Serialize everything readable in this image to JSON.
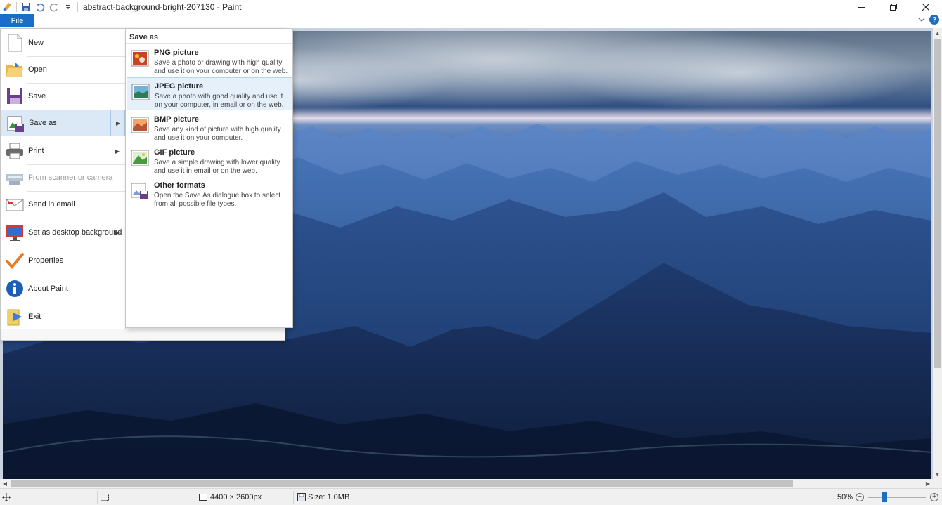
{
  "window": {
    "title": "abstract-background-bright-207130 - Paint",
    "quick_access": [
      "paint-app-icon",
      "save-icon",
      "undo-icon",
      "redo-icon",
      "customize-dropdown-icon"
    ]
  },
  "ribbon": {
    "file_tab": "File",
    "help_icon": "?"
  },
  "file_menu": {
    "items": [
      {
        "label": "New",
        "icon": "new-document-icon",
        "enabled": true,
        "submenu": false
      },
      {
        "label": "Open",
        "icon": "open-folder-icon",
        "enabled": true,
        "submenu": false
      },
      {
        "label": "Save",
        "icon": "save-disk-icon",
        "enabled": true,
        "submenu": false
      },
      {
        "label": "Save as",
        "icon": "save-as-icon",
        "enabled": true,
        "submenu": true,
        "selected": true
      },
      {
        "label": "Print",
        "icon": "printer-icon",
        "enabled": true,
        "submenu": true
      },
      {
        "label": "From scanner or camera",
        "icon": "scanner-icon",
        "enabled": false,
        "submenu": false
      },
      {
        "label": "Send in email",
        "icon": "email-icon",
        "enabled": true,
        "submenu": false
      },
      {
        "label": "Set as desktop background",
        "icon": "desktop-background-icon",
        "enabled": true,
        "submenu": true
      },
      {
        "label": "Properties",
        "icon": "checkmark-icon",
        "enabled": true,
        "submenu": false
      },
      {
        "label": "About Paint",
        "icon": "info-icon",
        "enabled": true,
        "submenu": false
      },
      {
        "label": "Exit",
        "icon": "exit-icon",
        "enabled": true,
        "submenu": false
      }
    ]
  },
  "save_as_menu": {
    "header": "Save as",
    "items": [
      {
        "title": "PNG picture",
        "desc": "Save a photo or drawing with high quality and use it on your computer or on the web.",
        "icon": "png-file-icon"
      },
      {
        "title": "JPEG picture",
        "desc": "Save a photo with good quality and use it on your computer, in email or on the web.",
        "icon": "jpeg-file-icon",
        "highlighted": true
      },
      {
        "title": "BMP picture",
        "desc": "Save any kind of picture with high quality and use it on your computer.",
        "icon": "bmp-file-icon"
      },
      {
        "title": "GIF picture",
        "desc": "Save a simple drawing with lower quality and use it in email or on the web.",
        "icon": "gif-file-icon"
      },
      {
        "title": "Other formats",
        "desc": "Open the Save As dialogue box to select from all possible file types.",
        "icon": "other-formats-icon"
      }
    ]
  },
  "status_bar": {
    "dimensions": "4400 × 2600px",
    "size": "Size: 1.0MB",
    "zoom": "50%"
  },
  "colors": {
    "accent": "#1b6ec2",
    "menu_selected": "#dbe8f6",
    "submenu_highlight": "#e5f0fb"
  }
}
